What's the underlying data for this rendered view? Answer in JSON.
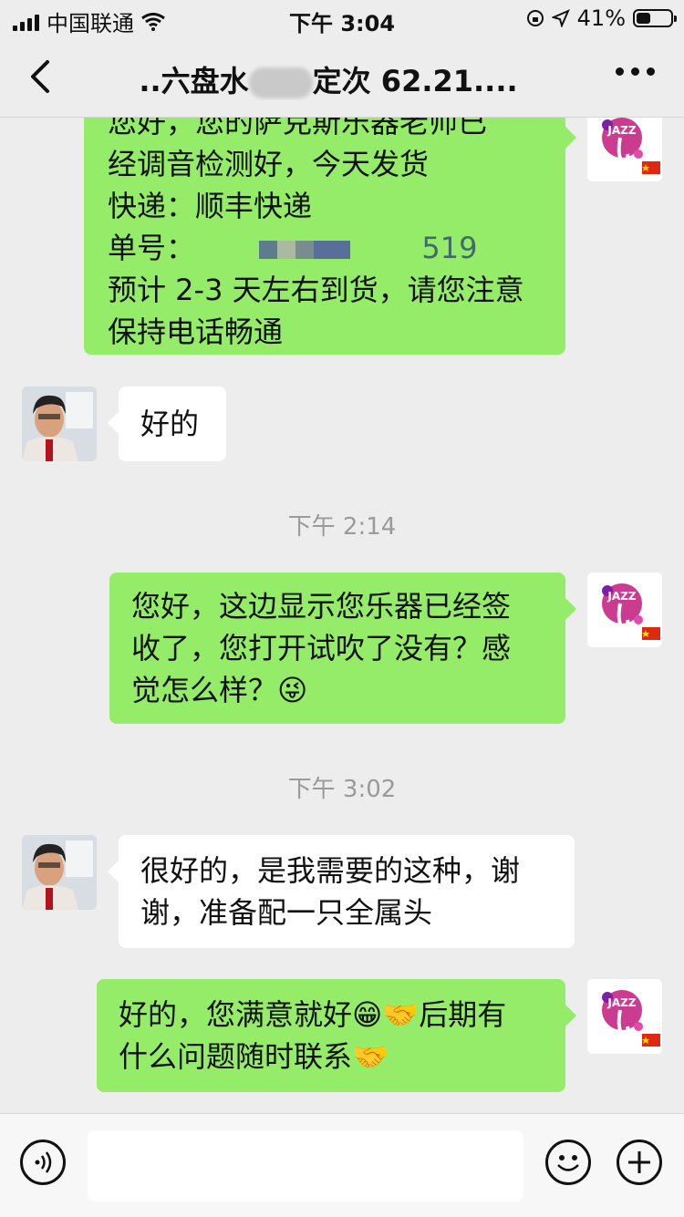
{
  "status_bar": {
    "carrier": "中国联通",
    "time": "下午 3:04",
    "battery_percent": "41%",
    "battery_level": 0.41
  },
  "nav": {
    "title_prefix": "..六盘水",
    "title_suffix": "定次 62.21...."
  },
  "messages": {
    "msg1": {
      "lines": [
        "您好，您的萨克斯乐器老师已",
        "经调音检测好，今天发货",
        "快递：顺丰快递",
        "单号：",
        "预计 2-3 天左右到货，请您注意",
        "保持电话畅通"
      ],
      "tracking_tail": "519"
    },
    "msg2": {
      "text": "好的"
    },
    "time1": "下午 2:14",
    "msg3": {
      "lines": [
        "您好，这边显示您乐器已经签",
        "收了，您打开试吹了没有？感",
        "觉怎么样？😜"
      ]
    },
    "time2": "下午 3:02",
    "msg4": {
      "lines": [
        "很好的，是我需要的这种，谢",
        "谢，准备配一只全属头"
      ]
    },
    "msg5": {
      "lines": [
        "好的，您满意就好😁🤝后期有",
        "什么问题随时联系🤝"
      ]
    }
  },
  "avatar_me": {
    "label": "JAZZ"
  },
  "colors": {
    "my_bubble": "#95ec69",
    "other_bubble": "#ffffff",
    "background": "#ededed"
  }
}
